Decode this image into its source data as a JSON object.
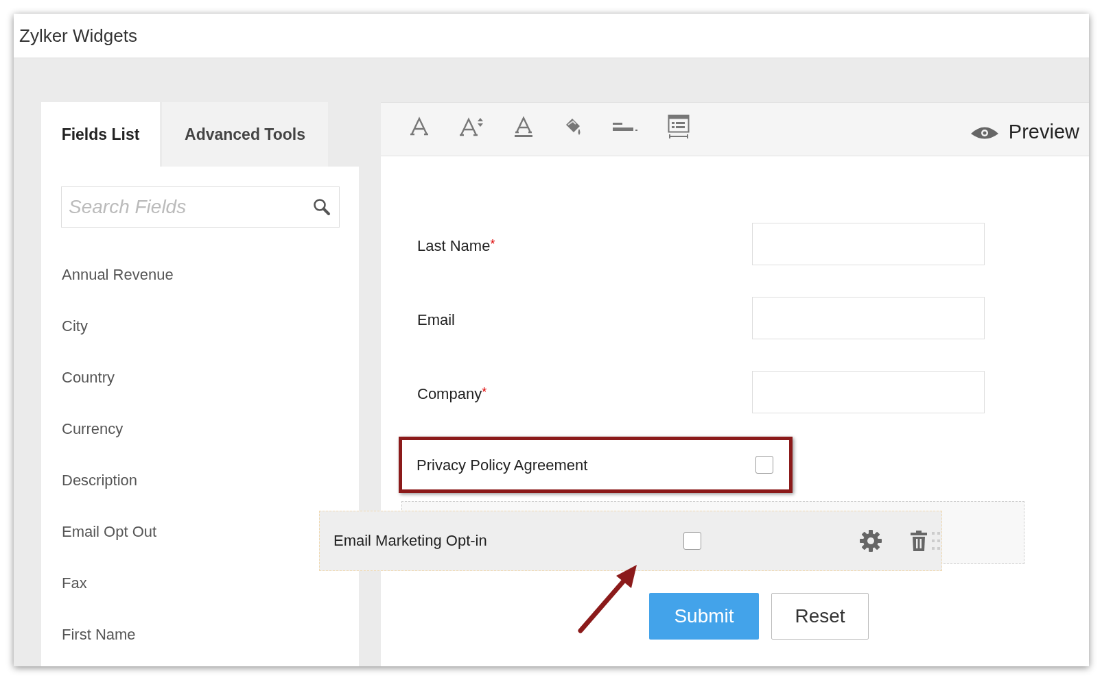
{
  "window": {
    "title": "Zylker Widgets"
  },
  "tabs": [
    {
      "label": "Fields List",
      "selected": true
    },
    {
      "label": "Advanced Tools",
      "selected": false
    }
  ],
  "search": {
    "placeholder": "Search Fields"
  },
  "fields_list": [
    "Annual Revenue",
    "City",
    "Country",
    "Currency",
    "Description",
    "Email Opt Out",
    "Fax",
    "First Name"
  ],
  "toolbar": {
    "preview": "Preview"
  },
  "form_fields": [
    {
      "kind": "text",
      "label": "Last Name",
      "required_mark": "*"
    },
    {
      "kind": "text",
      "label": "Email"
    },
    {
      "kind": "text",
      "label": "Company",
      "required_mark": "*"
    },
    {
      "kind": "checkbox",
      "label": "Privacy Policy Agreement",
      "highlighted": true,
      "checked": false
    }
  ],
  "dragged_field": {
    "label": "Email Marketing Opt-in",
    "checked": false
  },
  "buttons": [
    {
      "kind": "primary",
      "label": "Submit"
    },
    {
      "kind": "secondary",
      "label": "Reset"
    }
  ]
}
